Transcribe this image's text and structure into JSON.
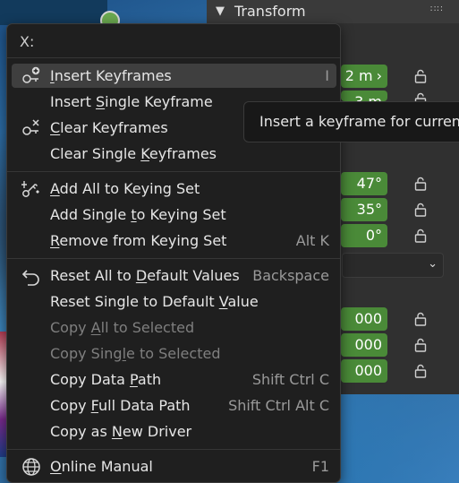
{
  "panel": {
    "title": "Transform",
    "location_fields": [
      "2 m",
      "3 m"
    ],
    "rotation_fields": [
      "47°",
      "35°",
      "0°"
    ],
    "scale_fields": [
      "000",
      "000",
      "000"
    ]
  },
  "menu": {
    "title": "X:",
    "items": [
      {
        "pre": "",
        "u": "I",
        "post": "nsert Keyframes",
        "shortcut": "I",
        "icon": "keyframe-insert-icon"
      },
      {
        "pre": "Insert ",
        "u": "S",
        "post": "ingle Keyframe",
        "shortcut": ""
      },
      {
        "pre": "",
        "u": "C",
        "post": "lear Keyframes",
        "shortcut": "",
        "icon": "keyframe-clear-icon"
      },
      {
        "pre": "Clear Single ",
        "u": "K",
        "post": "eyframes",
        "shortcut": ""
      },
      {
        "pre": "",
        "u": "A",
        "post": "dd All to Keying Set",
        "shortcut": "",
        "icon": "keying-set-icon"
      },
      {
        "pre": "Add Single ",
        "u": "t",
        "post": "o Keying Set",
        "shortcut": ""
      },
      {
        "pre": "",
        "u": "R",
        "post": "emove from Keying Set",
        "shortcut": "Alt K"
      },
      {
        "pre": "Reset All to ",
        "u": "D",
        "post": "efault Values",
        "shortcut": "Backspace",
        "icon": "reset-icon"
      },
      {
        "pre": "Reset Single to Default ",
        "u": "V",
        "post": "alue",
        "shortcut": ""
      },
      {
        "pre": "Copy ",
        "u": "A",
        "post": "ll to Selected",
        "shortcut": ""
      },
      {
        "pre": "Copy Sing",
        "u": "l",
        "post": "e to Selected",
        "shortcut": ""
      },
      {
        "pre": "Copy Data ",
        "u": "P",
        "post": "ath",
        "shortcut": "Shift Ctrl C"
      },
      {
        "pre": "Copy ",
        "u": "F",
        "post": "ull Data Path",
        "shortcut": "Shift Ctrl Alt C"
      },
      {
        "pre": "Copy as ",
        "u": "N",
        "post": "ew Driver",
        "shortcut": ""
      },
      {
        "pre": "",
        "u": "O",
        "post": "nline Manual",
        "shortcut": "F1",
        "icon": "globe-icon"
      }
    ]
  },
  "tooltip": {
    "text": "Insert a keyframe for curren"
  },
  "colors": {
    "field_green": "#4a8a38",
    "menu_bg": "#1f1f1f",
    "active_row": "#3f3f3f"
  }
}
